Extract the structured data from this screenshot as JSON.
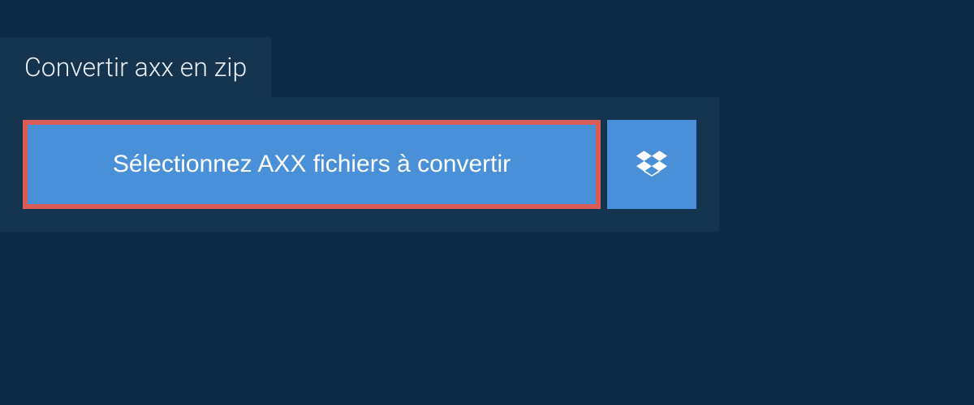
{
  "tab": {
    "title": "Convertir axx en zip"
  },
  "panel": {
    "select_button_label": "Sélectionnez AXX fichiers à convertir"
  },
  "colors": {
    "background": "#0f2a44",
    "panel": "#15344f",
    "button": "#4a90d9",
    "highlight_border": "#d95c57",
    "text_light": "#ffffff"
  }
}
